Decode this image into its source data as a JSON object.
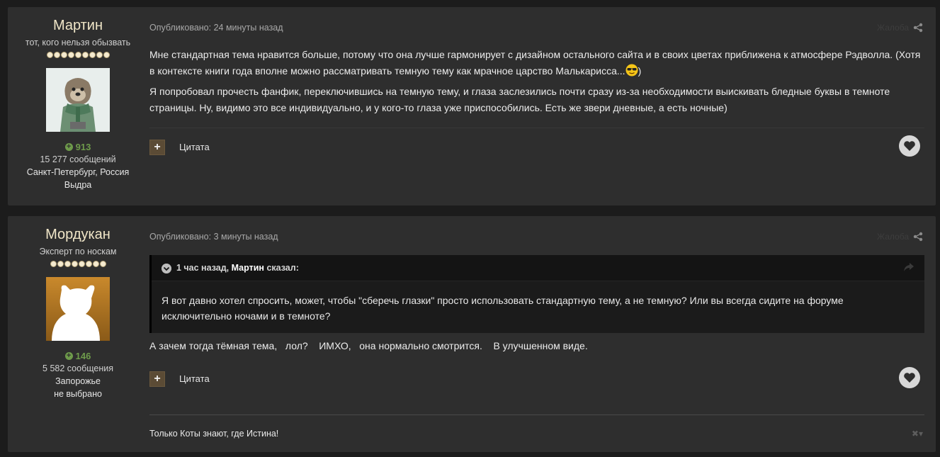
{
  "posts": [
    {
      "author": {
        "name": "Мартин",
        "title": "тот, кого нельзя обызвать",
        "pips": 9,
        "reputation": "913",
        "posts_count": "15 277 сообщений",
        "location": "Санкт-Петербург, Россия",
        "extra": "Выдра"
      },
      "posted": "Опубликовано: 24 минуты назад",
      "report": "Жалоба",
      "paragraphs": [
        "Мне стандартная тема нравится больше, потому что она лучше гармонирует с дизайном остального сайта и в своих цветах приближена к атмосфере Рэдволла. (Хотя в контексте книги года вполне можно рассматривать темную тему как мрачное царство Малькарисса...",
        "Я попробовал прочесть фанфик, переключившись на темную тему, и глаза заслезились почти сразу из-за необходимости выискивать бледные буквы в темноте страницы. Ну, видимо это все индивидуально, и у кого-то глаза уже приспособились. Есть же звери дневные, а есть ночные)"
      ],
      "p1_tail": ")",
      "quote_label": "Цитата"
    },
    {
      "author": {
        "name": "Мордукан",
        "title": "Эксперт по носкам",
        "pips": 8,
        "reputation": "146",
        "posts_count": "5 582 сообщения",
        "location": "Запорожье",
        "extra": "не выбрано"
      },
      "posted": "Опубликовано: 3 минуты назад",
      "report": "Жалоба",
      "quote": {
        "time": "1 час назад, ",
        "who": "Мартин",
        "said": " сказал:",
        "text": "Я вот давно хотел спросить, может, чтобы \"сберечь глазки\" просто использовать стандартную тему, а не темную? Или вы всегда сидите на форуме исключительно ночами и в темноте?"
      },
      "reply": "А зачем тогда тёмная тема,   лол?    ИМХО,   она нормально смотрится.    В улучшенном виде.",
      "quote_label": "Цитата",
      "signature": "Только Коты знают, где Истина!"
    }
  ],
  "colors": {
    "background": "#1c1c1c",
    "panel": "#2e2e2e",
    "author_name": "#f0e6c8",
    "reputation": "#6e9b4b",
    "plus_button": "#5b4b35"
  },
  "icons": {
    "share": "share-icon",
    "heart": "heart-icon",
    "plus": "plus-icon",
    "chevron": "chevron-down-icon",
    "forward": "forward-icon",
    "emoji": "sunglasses-emoji-icon"
  }
}
